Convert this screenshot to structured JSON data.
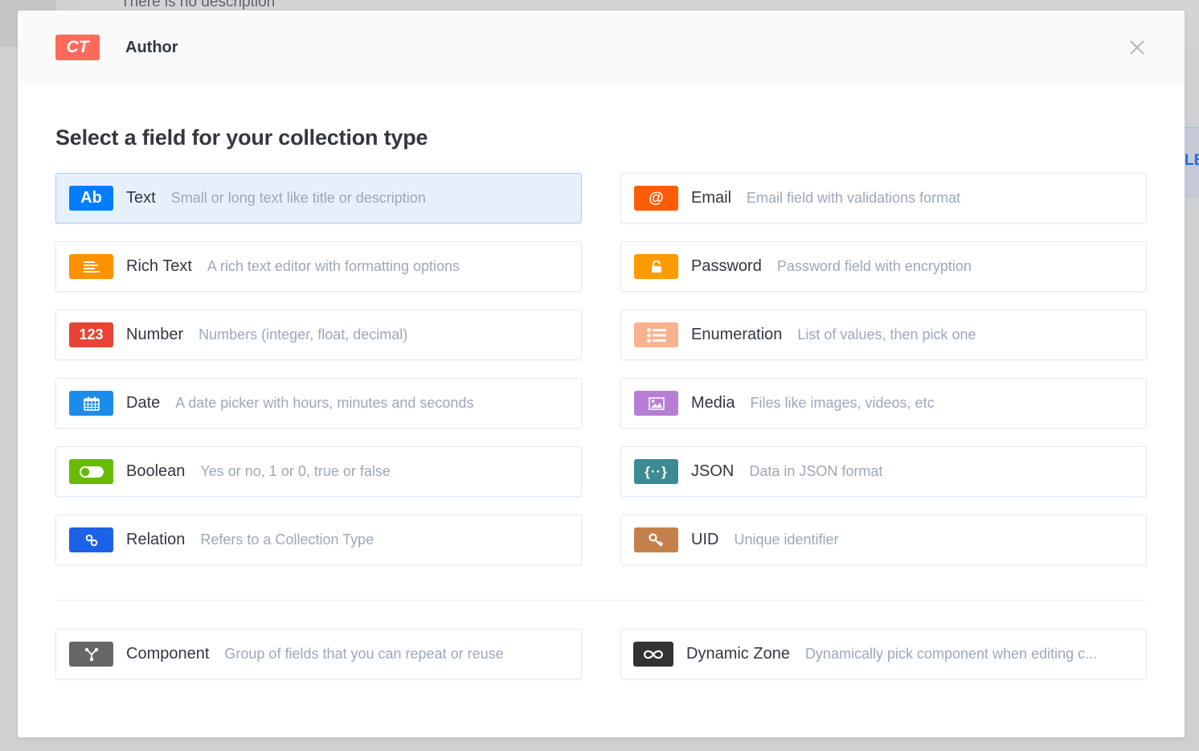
{
  "background": {
    "description_text": "There is no description",
    "right_button_partial_label": "LE"
  },
  "modal": {
    "badge": "CT",
    "title": "Author",
    "close_icon": "close-icon",
    "section_title": "Select a field for your collection type",
    "fields": [
      {
        "id": "text",
        "name": "Text",
        "description": "Small or long text like title or description",
        "icon": "text-ab-icon",
        "icon_text": "Ab",
        "color": "#007eff",
        "selected": true
      },
      {
        "id": "email",
        "name": "Email",
        "description": "Email field with validations format",
        "icon": "at-sign-icon",
        "icon_text": "@",
        "color": "#ff5d00"
      },
      {
        "id": "richtext",
        "name": "Rich Text",
        "description": "A rich text editor with formatting options",
        "icon": "align-left-icon",
        "color": "#ff9200"
      },
      {
        "id": "password",
        "name": "Password",
        "description": "Password field with encryption",
        "icon": "unlock-icon",
        "color": "#ff9a00"
      },
      {
        "id": "number",
        "name": "Number",
        "description": "Numbers (integer, float, decimal)",
        "icon": "number-icon",
        "icon_text": "123",
        "color": "#e94333"
      },
      {
        "id": "enumeration",
        "name": "Enumeration",
        "description": "List of values, then pick one",
        "icon": "list-icon",
        "color": "#fab28f"
      },
      {
        "id": "date",
        "name": "Date",
        "description": "A date picker with hours, minutes and seconds",
        "icon": "calendar-icon",
        "color": "#1c8cea"
      },
      {
        "id": "media",
        "name": "Media",
        "description": "Files like images, videos, etc",
        "icon": "image-icon",
        "color": "#b67fd5"
      },
      {
        "id": "boolean",
        "name": "Boolean",
        "description": "Yes or no, 1 or 0, true or false",
        "icon": "toggle-icon",
        "color": "#68bb00"
      },
      {
        "id": "json",
        "name": "JSON",
        "description": "Data in JSON format",
        "icon": "braces-icon",
        "icon_text": "{··}",
        "color": "#3c8a93"
      },
      {
        "id": "relation",
        "name": "Relation",
        "description": "Refers to a Collection Type",
        "icon": "link-icon",
        "color": "#1b62e6"
      },
      {
        "id": "uid",
        "name": "UID",
        "description": "Unique identifier",
        "icon": "key-icon",
        "color": "#c4804b"
      }
    ],
    "extra_fields": [
      {
        "id": "component",
        "name": "Component",
        "description": "Group of fields that you can repeat or reuse",
        "icon": "component-icon",
        "color": "#666666"
      },
      {
        "id": "dynamiczone",
        "name": "Dynamic Zone",
        "description": "Dynamically pick component when editing c...",
        "icon": "infinity-icon",
        "color": "#333333"
      }
    ]
  }
}
